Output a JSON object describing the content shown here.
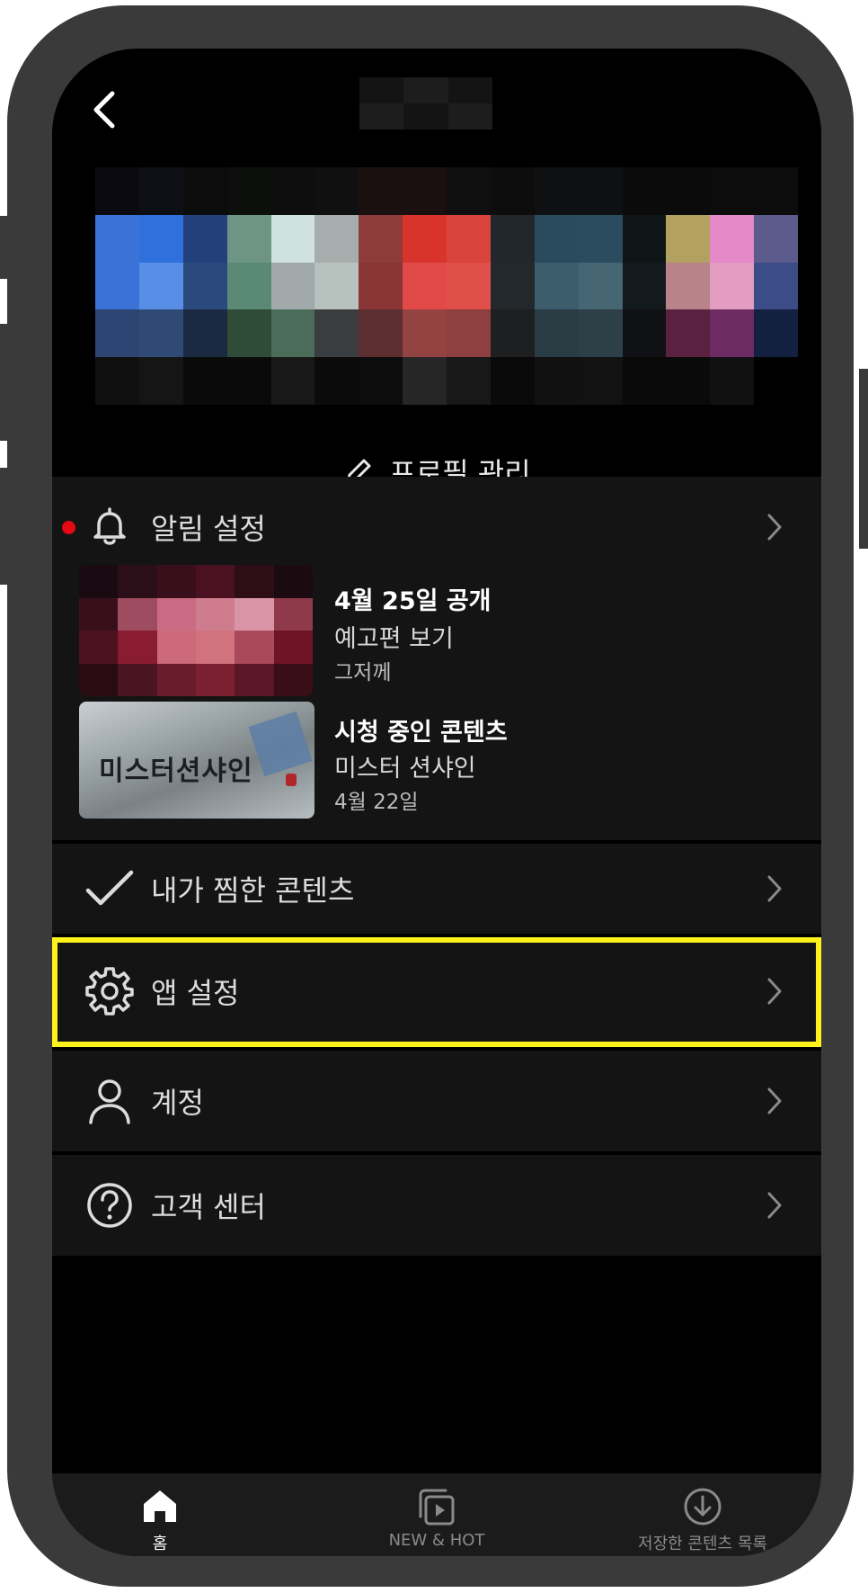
{
  "header": {
    "back_icon": "chevron-left-icon",
    "title": ""
  },
  "profile": {
    "manage_label": "프로필 관리",
    "manage_icon": "pencil-icon"
  },
  "notifications": {
    "label": "알림 설정",
    "icon": "bell-icon",
    "has_new_indicator": true,
    "items": [
      {
        "title": "4월 25일 공개",
        "subtitle": "예고편 보기",
        "time": "그저께"
      },
      {
        "title": "시청 중인 콘텐츠",
        "subtitle": "미스터 션샤인",
        "time": "4월 22일",
        "poster_text": "미스터션샤인"
      }
    ]
  },
  "menu": {
    "my_list": {
      "label": "내가 찜한 콘텐츠",
      "icon": "checkmark-icon"
    },
    "app_settings": {
      "label": "앱 설정",
      "icon": "gear-icon",
      "highlighted": true
    },
    "account": {
      "label": "계정",
      "icon": "person-icon"
    },
    "help": {
      "label": "고객 센터",
      "icon": "question-circle-icon"
    }
  },
  "tabbar": {
    "items": [
      {
        "label": "홈",
        "icon": "home-icon",
        "active": true
      },
      {
        "label": "NEW & HOT",
        "icon": "play-stack-icon",
        "active": false
      },
      {
        "label": "저장한 콘텐츠 목록",
        "icon": "download-circle-icon",
        "active": false
      }
    ]
  },
  "colors": {
    "highlight": "#fff21c",
    "indicator": "#e50914",
    "background": "#000000",
    "section": "#141414"
  }
}
